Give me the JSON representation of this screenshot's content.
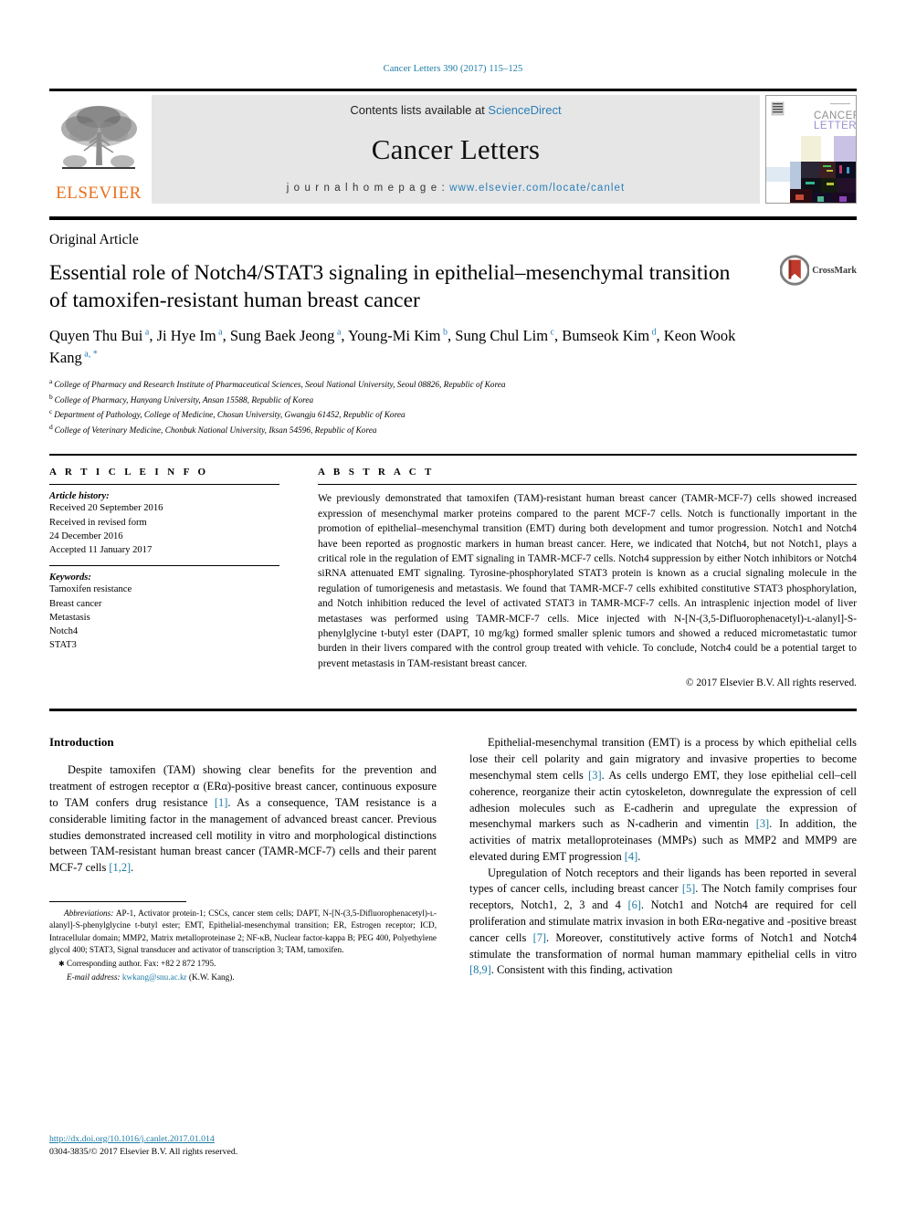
{
  "running_head": "Cancer Letters 390 (2017) 115–125",
  "masthead": {
    "publisher_logo_name": "elsevier-tree-logo",
    "publisher_wordmark": "ELSEVIER",
    "contents_prefix": "Contents lists available at ",
    "contents_link": "ScienceDirect",
    "journal_title": "Cancer Letters",
    "homepage_prefix": "j o u r n a l   h o m e p a g e :  ",
    "homepage_url": "www.elsevier.com/locate/canlet",
    "cover_title_line1": "CANCER",
    "cover_title_line2": "LETTERS"
  },
  "title_block": {
    "kicker": "Original Article",
    "title": "Essential role of Notch4/STAT3 signaling in epithelial–mesenchymal transition of tamoxifen-resistant human breast cancer",
    "crossmark_label": "CrossMark",
    "authors": [
      {
        "name": "Quyen Thu Bui",
        "sup": "a"
      },
      {
        "name": "Ji Hye Im",
        "sup": "a"
      },
      {
        "name": "Sung Baek Jeong",
        "sup": "a"
      },
      {
        "name": "Young-Mi Kim",
        "sup": "b"
      },
      {
        "name": "Sung Chul Lim",
        "sup": "c"
      },
      {
        "name": "Bumseok Kim",
        "sup": "d"
      },
      {
        "name": "Keon Wook Kang",
        "sup": "a, *"
      }
    ],
    "affiliations": [
      {
        "mark": "a",
        "text": "College of Pharmacy and Research Institute of Pharmaceutical Sciences, Seoul National University, Seoul 08826, Republic of Korea"
      },
      {
        "mark": "b",
        "text": "College of Pharmacy, Hanyang University, Ansan 15588, Republic of Korea"
      },
      {
        "mark": "c",
        "text": "Department of Pathology, College of Medicine, Chosun University, Gwangju 61452, Republic of Korea"
      },
      {
        "mark": "d",
        "text": "College of Veterinary Medicine, Chonbuk National University, Iksan 54596, Republic of Korea"
      }
    ]
  },
  "article_info": {
    "heading": "A R T I C L E   I N F O",
    "history_label": "Article history:",
    "history_lines": [
      "Received 20 September 2016",
      "Received in revised form",
      "24 December 2016",
      "Accepted 11 January 2017"
    ],
    "keywords_label": "Keywords:",
    "keywords": [
      "Tamoxifen resistance",
      "Breast cancer",
      "Metastasis",
      "Notch4",
      "STAT3"
    ]
  },
  "abstract": {
    "heading": "A B S T R A C T",
    "text": "We previously demonstrated that tamoxifen (TAM)-resistant human breast cancer (TAMR-MCF-7) cells showed increased expression of mesenchymal marker proteins compared to the parent MCF-7 cells. Notch is functionally important in the promotion of epithelial–mesenchymal transition (EMT) during both development and tumor progression. Notch1 and Notch4 have been reported as prognostic markers in human breast cancer. Here, we indicated that Notch4, but not Notch1, plays a critical role in the regulation of EMT signaling in TAMR-MCF-7 cells. Notch4 suppression by either Notch inhibitors or Notch4 siRNA attenuated EMT signaling. Tyrosine-phosphorylated STAT3 protein is known as a crucial signaling molecule in the regulation of tumorigenesis and metastasis. We found that TAMR-MCF-7 cells exhibited constitutive STAT3 phosphorylation, and Notch inhibition reduced the level of activated STAT3 in TAMR-MCF-7 cells. An intrasplenic injection model of liver metastases was performed using TAMR-MCF-7 cells. Mice injected with N-[N-(3,5-Difluorophenacetyl)-ʟ-alanyl]-S-phenylglycine t-butyl ester (DAPT, 10 mg/kg) formed smaller splenic tumors and showed a reduced micrometastatic tumor burden in their livers compared with the control group treated with vehicle. To conclude, Notch4 could be a potential target to prevent metastasis in TAM-resistant breast cancer.",
    "copyright": "© 2017 Elsevier B.V. All rights reserved."
  },
  "body": {
    "section_heading": "Introduction",
    "left_paragraph": {
      "part1": "Despite tamoxifen (TAM) showing clear benefits for the prevention and treatment of estrogen receptor α (ERα)-positive breast cancer, continuous exposure to TAM confers drug resistance ",
      "ref1": "[1]",
      "part2": ". As a consequence, TAM resistance is a considerable limiting factor in the management of advanced breast cancer. Previous studies demonstrated increased cell motility in vitro and morphological distinctions between TAM-resistant human breast cancer (TAMR-MCF-7) cells and their parent MCF-7 cells ",
      "ref2": "[1,2]",
      "part3": "."
    },
    "right_paragraph_1": {
      "part1": "Epithelial-mesenchymal transition (EMT) is a process by which epithelial cells lose their cell polarity and gain migratory and invasive properties to become mesenchymal stem cells ",
      "ref1": "[3]",
      "part2": ". As cells undergo EMT, they lose epithelial cell–cell coherence, reorganize their actin cytoskeleton, downregulate the expression of cell adhesion molecules such as E-cadherin and upregulate the expression of mesenchymal markers such as N-cadherin and vimentin ",
      "ref2": "[3]",
      "part3": ". In addition, the activities of matrix metalloproteinases (MMPs) such as MMP2 and MMP9 are elevated during EMT progression ",
      "ref3": "[4]",
      "part4": "."
    },
    "right_paragraph_2": {
      "part1": "Upregulation of Notch receptors and their ligands has been reported in several types of cancer cells, including breast cancer ",
      "ref1": "[5]",
      "part2": ". The Notch family comprises four receptors, Notch1, 2, 3 and 4 ",
      "ref2": "[6]",
      "part3": ". Notch1 and Notch4 are required for cell proliferation and stimulate matrix invasion in both ERα-negative and -positive breast cancer cells ",
      "ref3": "[7]",
      "part4": ". Moreover, constitutively active forms of Notch1 and Notch4 stimulate the transformation of normal human mammary epithelial cells in vitro ",
      "ref4": "[8,9]",
      "part5": ". Consistent with this finding, activation"
    }
  },
  "footnotes": {
    "abbrev_label": "Abbreviations:",
    "abbrev_text": " AP-1, Activator protein-1; CSCs, cancer stem cells; DAPT, N-[N-(3,5-Difluorophenacetyl)-ʟ-alanyl]-S-phenylglycine t-butyl ester; EMT, Epithelial-mesenchymal transition; ER, Estrogen receptor; ICD, Intracellular domain; MMP2, Matrix metalloproteinase 2; NF-κB, Nuclear factor-kappa B; PEG 400, Polyethylene glycol 400; STAT3, Signal transducer and activator of transcription 3; TAM, tamoxifen.",
    "corresponding": "Corresponding author. Fax: +82 2 872 1795.",
    "email_label": "E-mail address:",
    "email": "kwkang@snu.ac.kr",
    "email_suffix": " (K.W. Kang).",
    "doi_url": "http://dx.doi.org/10.1016/j.canlet.2017.01.014",
    "issn_line": "0304-3835/© 2017 Elsevier B.V. All rights reserved."
  },
  "colors": {
    "link": "#1b7ba5",
    "elsevier_orange": "#e8701a",
    "banner_gray": "#e6e6e6"
  }
}
